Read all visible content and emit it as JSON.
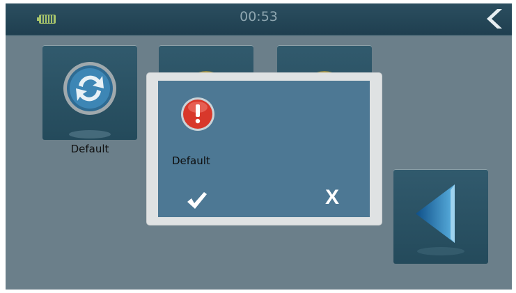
{
  "statusbar": {
    "time": "00:53",
    "battery_icon": "battery-icon",
    "back_icon": "chevron-left-icon"
  },
  "tiles": [
    {
      "label": "Default",
      "icon": "refresh-icon"
    },
    {
      "label": "",
      "icon": "app-icon"
    },
    {
      "label": "",
      "icon": "globe-icon"
    },
    {
      "label": "",
      "icon": "back-arrow-icon"
    }
  ],
  "dialog": {
    "icon": "warning-icon",
    "message": "Default",
    "ok_icon": "checkmark-icon",
    "cancel_label": "X"
  },
  "colors": {
    "background": "#6b7f8a",
    "statusbar": "#1f3f50",
    "tile": "#244a5b",
    "dialog_panel": "#4d7894",
    "dialog_frame": "#dfe2e3",
    "warning": "#d8382b"
  }
}
